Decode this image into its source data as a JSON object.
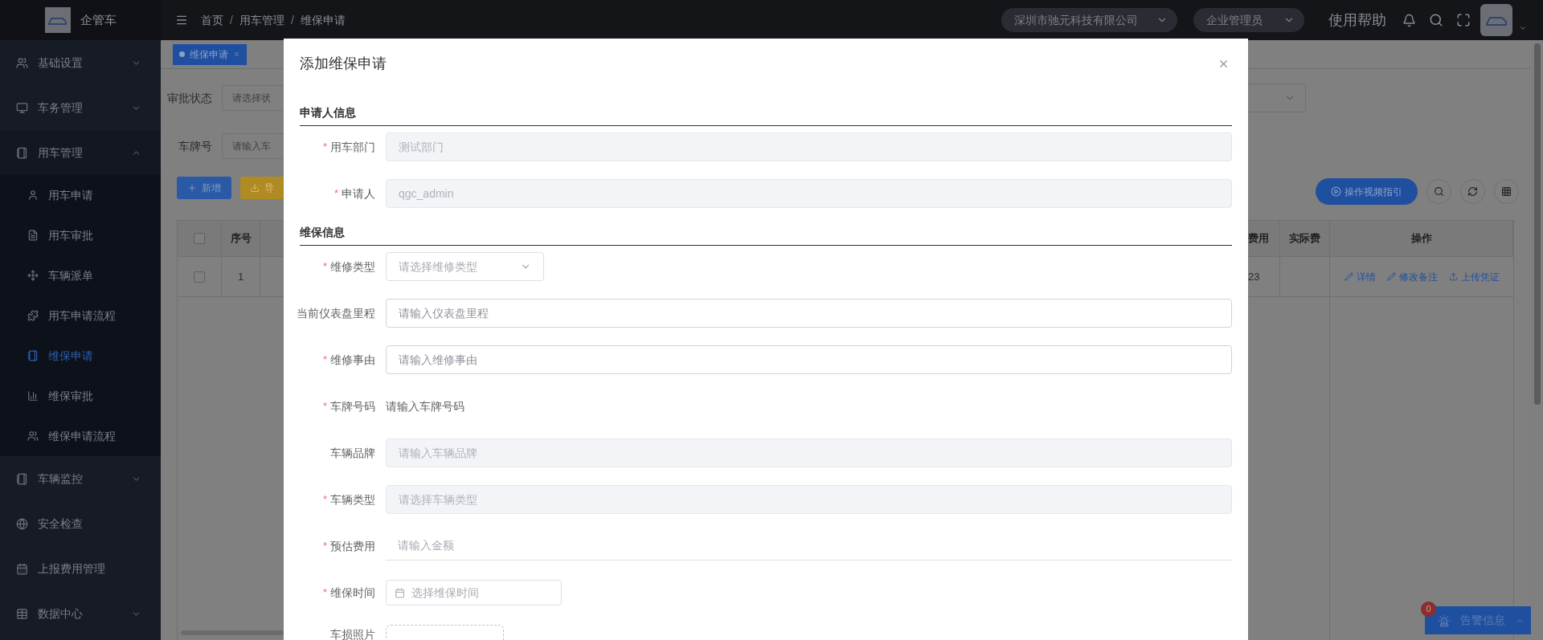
{
  "sidebar": {
    "brand": "企管车",
    "items": [
      {
        "label": "基础设置",
        "kind": "group",
        "expanded": false
      },
      {
        "label": "车务管理",
        "kind": "group",
        "expanded": false
      },
      {
        "label": "用车管理",
        "kind": "group",
        "expanded": true,
        "children": [
          {
            "label": "用车申请",
            "selected": false
          },
          {
            "label": "用车审批",
            "selected": false
          },
          {
            "label": "车辆派单",
            "selected": false
          },
          {
            "label": "用车申请流程",
            "selected": false
          },
          {
            "label": "维保申请",
            "selected": true
          },
          {
            "label": "维保审批",
            "selected": false
          },
          {
            "label": "维保申请流程",
            "selected": false
          }
        ]
      },
      {
        "label": "车辆监控",
        "kind": "group",
        "expanded": false
      },
      {
        "label": "安全检查",
        "kind": "link"
      },
      {
        "label": "上报费用管理",
        "kind": "link"
      },
      {
        "label": "数据中心",
        "kind": "group",
        "expanded": false
      }
    ]
  },
  "header": {
    "breadcrumb": [
      "首页",
      "用车管理",
      "维保申请"
    ],
    "separator": "/",
    "company": "深圳市驰元科技有限公司",
    "role": "企业管理员",
    "help": "使用帮助"
  },
  "page": {
    "tabs": [
      {
        "label": "维保申请",
        "selected": true
      }
    ],
    "filters": [
      {
        "label": "审批状态",
        "placeholder": "请选择状"
      },
      {
        "label": "车牌号",
        "placeholder": "请输入车"
      }
    ],
    "buttons": [
      {
        "label": "新增",
        "kind": "primary"
      },
      {
        "label": "导",
        "kind": "warning"
      }
    ],
    "video_guide": "操作视频指引",
    "table_left": {
      "columns": [
        "序号"
      ],
      "header_checked": false,
      "rows": [
        {
          "checked": false,
          "cells": [
            "1"
          ]
        }
      ]
    },
    "table_right": {
      "columns": [
        "费用",
        "实际费",
        "操作"
      ],
      "rows": [
        {
          "cells": [
            "23",
            ""
          ],
          "actions": [
            "详情",
            "修改备注",
            "上传凭证"
          ]
        }
      ]
    },
    "alert": {
      "label": "告警信息",
      "count": "0"
    }
  },
  "modal": {
    "title": "添加维保申请",
    "required_mark": "*",
    "sections": [
      {
        "title": "申请人信息",
        "fields": [
          {
            "label": "用车部门",
            "required": true,
            "kind": "input",
            "disabled": true,
            "value": "测试部门"
          },
          {
            "label": "申请人",
            "required": true,
            "kind": "input",
            "disabled": true,
            "value": "qgc_admin"
          }
        ]
      },
      {
        "title": "维保信息",
        "fields": [
          {
            "label": "维修类型",
            "required": true,
            "kind": "select",
            "placeholder": "请选择维修类型"
          },
          {
            "label": "当前仪表盘里程",
            "required": false,
            "kind": "input",
            "disabled": false,
            "placeholder": "请输入仪表盘里程"
          },
          {
            "label": "维修事由",
            "required": true,
            "kind": "input",
            "disabled": false,
            "placeholder": "请输入维修事由"
          },
          {
            "label": "车牌号码",
            "required": true,
            "kind": "text",
            "value": "请输入车牌号码"
          },
          {
            "label": "车辆品牌",
            "required": false,
            "kind": "input",
            "disabled": true,
            "placeholder": "请输入车辆品牌"
          },
          {
            "label": "车辆类型",
            "required": true,
            "kind": "input",
            "disabled": true,
            "placeholder": "请选择车辆类型"
          },
          {
            "label": "预估费用",
            "required": true,
            "kind": "underline",
            "placeholder": "请输入金额"
          },
          {
            "label": "维保时间",
            "required": true,
            "kind": "date",
            "placeholder": "选择维保时间"
          },
          {
            "label": "车损照片",
            "required": false,
            "kind": "upload"
          }
        ]
      }
    ]
  }
}
